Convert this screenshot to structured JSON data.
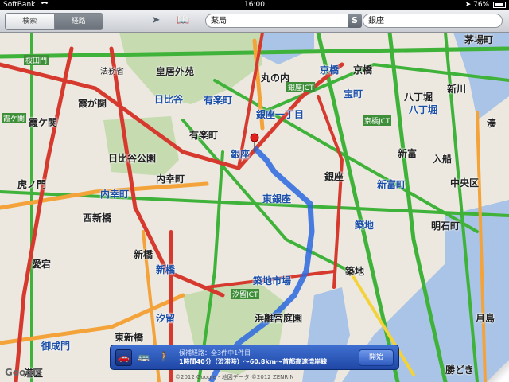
{
  "statusbar": {
    "carrier": "SoftBank",
    "time": "16:00",
    "battery": "76%"
  },
  "toolbar": {
    "search_tab": "検索",
    "route_tab": "経路",
    "start_field": "薬局",
    "end_field": "銀座",
    "swap_label": "S"
  },
  "map": {
    "labels": {
      "sakuradamon": "桜田門",
      "kasumigaseki": "霞が関",
      "kasumigaseki_sta": "霞ケ関",
      "toranomon": "虎ノ門",
      "uchisaiwaicho": "内幸町",
      "nishishinbashi": "西新橋",
      "atago": "愛宕",
      "onarimon": "御成門",
      "hibiya": "日比谷",
      "hibiya_park": "日比谷公園",
      "uchisaiwaicho2": "内幸町",
      "yurakucho": "有楽町",
      "yurakucho_sta": "有楽町",
      "ginza_itchome": "銀座一丁目",
      "ginza": "銀座",
      "higashi_ginza": "東銀座",
      "shinbashi": "新橋",
      "shinbashi2": "新橋",
      "shiodome": "汐留",
      "tsukiji_shijo": "築地市場",
      "hamarikyu": "浜離宮庭園",
      "tsukiji": "築地",
      "tsukiji2": "築地",
      "shintomicho": "新富町",
      "shintomi": "新富",
      "chuo_ku": "中央区",
      "akashicho": "明石町",
      "hatchobori": "八丁堀",
      "hatchobori2": "八丁堀",
      "takaracho": "宝町",
      "kyobashi": "京橋",
      "kyobashi2": "京橋",
      "marunouchi": "丸の内",
      "kokyo_gaien": "皇居外苑",
      "kayabacho": "茅場町",
      "minato": "湊",
      "irifune": "入船",
      "tsukishima": "月島",
      "kachidoki": "勝どき",
      "minato_ku": "港区",
      "ginza_jct": "銀座JCT",
      "kyobashi_jct": "京橋JCT",
      "shiodome_jct": "汐留JCT",
      "ginza_pin": "銀座",
      "google": "Google",
      "higashi_shinbashi": "東新橋",
      "shinkawa": "新川",
      "hounou": "法務省"
    }
  },
  "route": {
    "line1": "候補経路：全3件中1件目",
    "line2": "1時間40分（渋滞時）〜60.8km〜首都高速湾岸線",
    "start_button": "開始",
    "copyright": "©2012 Google - 地図データ ©2012 ZENRIN"
  }
}
